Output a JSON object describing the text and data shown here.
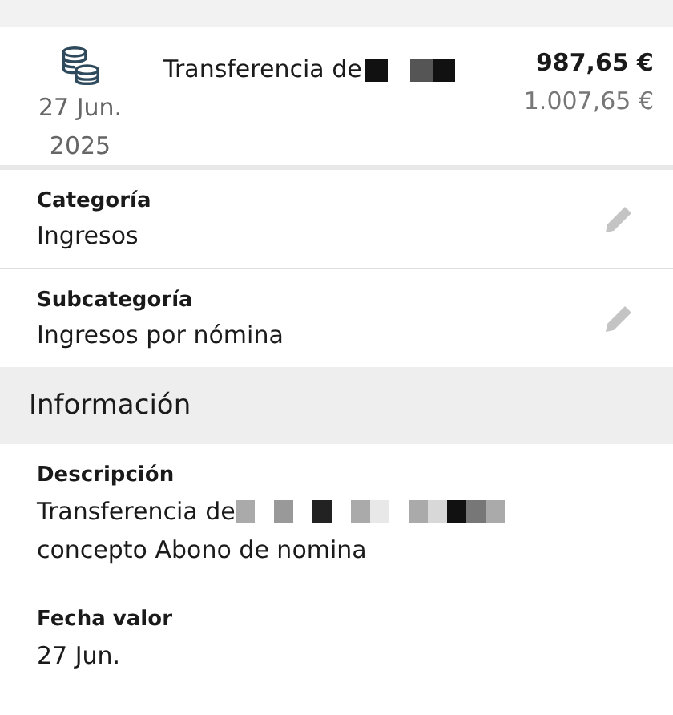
{
  "transaction": {
    "title": "Transferencia de",
    "date_day": "27 Jun.",
    "date_year": "2025",
    "amount": "987,65 €",
    "balance": "1.007,65 €"
  },
  "fields": [
    {
      "label": "Categoría",
      "value": "Ingresos",
      "editable": true
    },
    {
      "label": "Subcategoría",
      "value": "Ingresos por nómina",
      "editable": true
    }
  ],
  "section": {
    "title": "Información"
  },
  "info": [
    {
      "label": "Descripción",
      "lines": [
        "Transferencia de",
        "concepto Abono de nomina"
      ],
      "redacted": true
    },
    {
      "label": "Fecha valor",
      "lines": [
        "27 Jun."
      ],
      "redacted": false
    }
  ]
}
